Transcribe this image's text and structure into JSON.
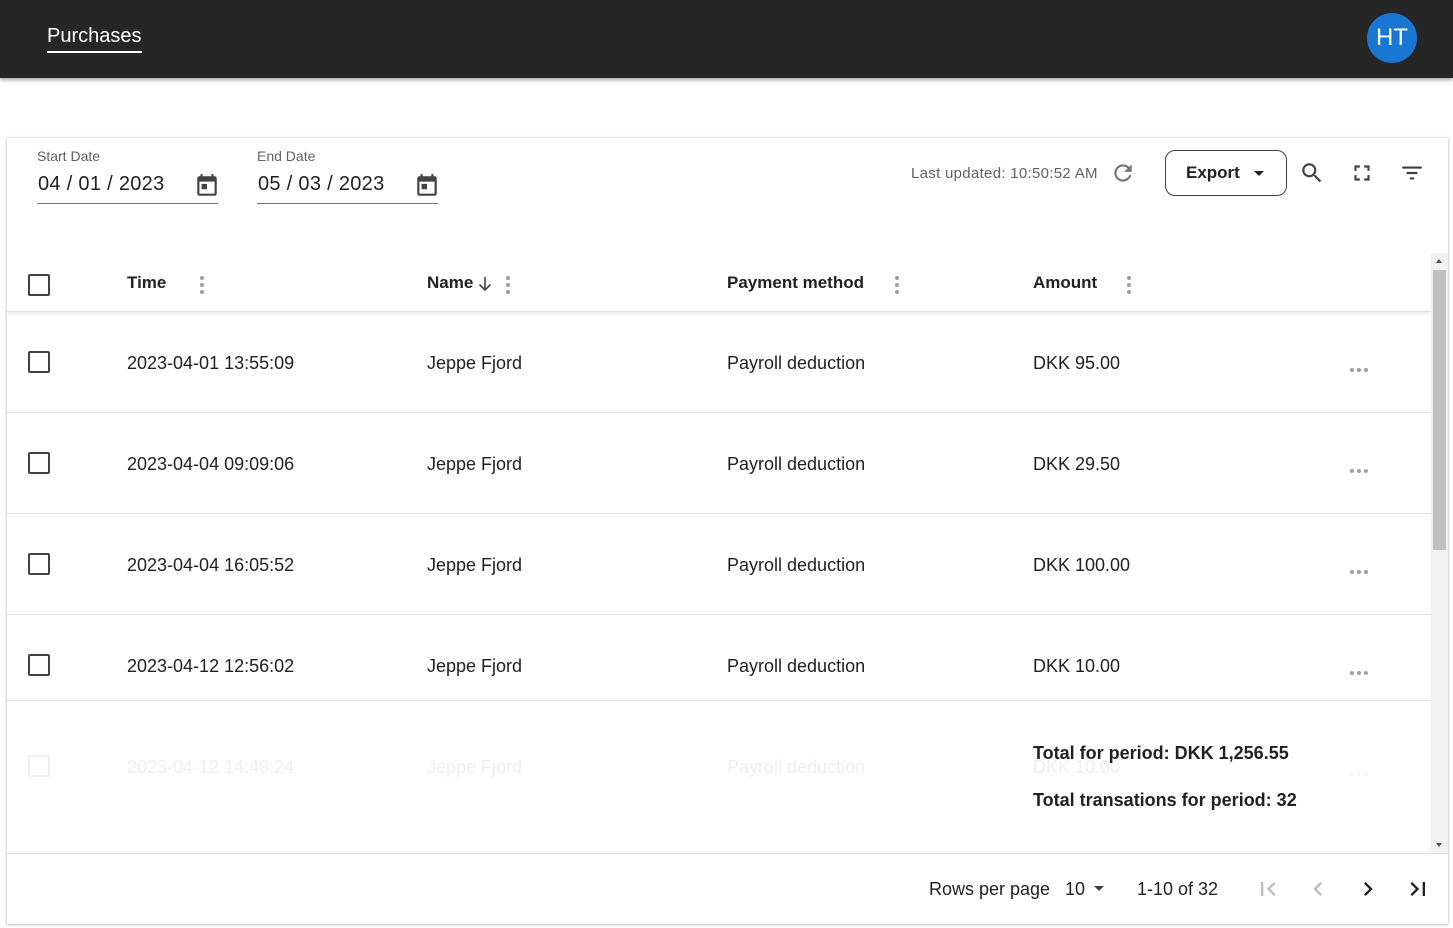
{
  "topbar": {
    "nav_tab": "Purchases",
    "avatar_initials": "HT",
    "avatar_color": "#1976d2",
    "background": "#262626"
  },
  "filters": {
    "start_date": {
      "label": "Start Date",
      "value": "04 / 01 / 2023"
    },
    "end_date": {
      "label": "End Date",
      "value": "05 / 03 / 2023"
    }
  },
  "toolbar": {
    "last_updated": "Last updated: 10:50:52 AM",
    "export_label": "Export",
    "icons": [
      "refresh-icon",
      "search-icon",
      "fullscreen-icon",
      "filter-icon"
    ]
  },
  "table": {
    "columns": [
      {
        "label": "Time"
      },
      {
        "label": "Name",
        "sorted": "descending"
      },
      {
        "label": "Payment method"
      },
      {
        "label": "Amount"
      }
    ],
    "rows": [
      {
        "time": "2023-04-01 13:55:09",
        "name": "Jeppe Fjord",
        "payment_method": "Payroll deduction",
        "amount": "DKK 95.00"
      },
      {
        "time": "2023-04-04 09:09:06",
        "name": "Jeppe Fjord",
        "payment_method": "Payroll deduction",
        "amount": "DKK 29.50"
      },
      {
        "time": "2023-04-04 16:05:52",
        "name": "Jeppe Fjord",
        "payment_method": "Payroll deduction",
        "amount": "DKK 100.00"
      },
      {
        "time": "2023-04-12 12:56:02",
        "name": "Jeppe Fjord",
        "payment_method": "Payroll deduction",
        "amount": "DKK 10.00"
      },
      {
        "time": "2023-04-12 14:48:24",
        "name": "Jeppe Fjord",
        "payment_method": "Payroll deduction",
        "amount": "DKK 10.00"
      }
    ],
    "totals": {
      "period_total": "Total for period: DKK 1,256.55",
      "transactions_total": "Total transations for period: 32"
    }
  },
  "pagination": {
    "rows_per_page_label": "Rows per page",
    "rows_per_page_value": "10",
    "range": "1-10 of 32"
  }
}
